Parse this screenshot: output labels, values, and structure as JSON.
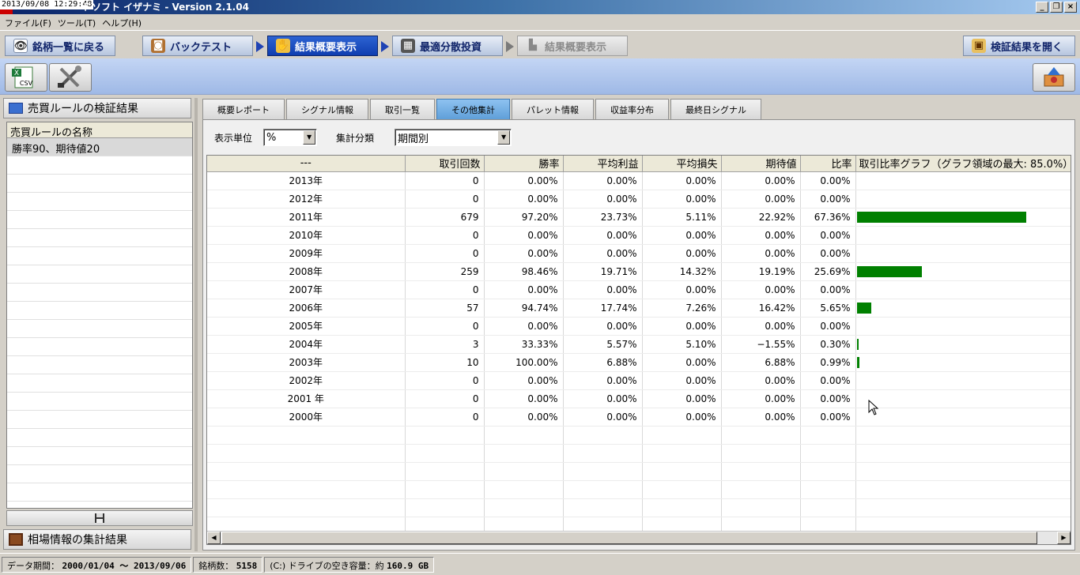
{
  "titlebar": {
    "timestamp": "2013/09/08 12:29:48",
    "title": "ドソフト イザナミ - Version 2.1.04",
    "buttons": {
      "minimize": "_",
      "restore": "❐",
      "close": "×"
    }
  },
  "menu": [
    "ファイル(F)",
    "ツール(T)",
    "ヘルプ(H)"
  ],
  "nav": {
    "back": "銘柄一覧に戻る",
    "backtest": "バックテスト",
    "summary": "結果概要表示",
    "optimal": "最適分散投資",
    "summary2": "結果概要表示",
    "open_results": "検証結果を開く",
    "icons": {
      "back": "eye-icon",
      "backtest": "bag-icon",
      "summary": "chart-hand-icon",
      "optimal": "grid-icon",
      "summary2": "bar-chart-icon",
      "open_results": "folder-icon"
    }
  },
  "toolbar": {
    "csv_label": "CSV"
  },
  "left_panel": {
    "header": "売買ルールの検証結果",
    "column_header": "売買ルールの名称",
    "rules": [
      "勝率90、期待値20"
    ],
    "footer": "相場情報の集計結果"
  },
  "tabs": [
    "概要レポート",
    "シグナル情報",
    "取引一覧",
    "その他集計",
    "パレット情報",
    "収益率分布",
    "最終日シグナル"
  ],
  "active_tab": 3,
  "filters": {
    "unit_label": "表示単位",
    "unit_value": "%",
    "category_label": "集計分類",
    "category_value": "期間別"
  },
  "table": {
    "headers": [
      "---",
      "取引回数",
      "勝率",
      "平均利益",
      "平均損失",
      "期待値",
      "比率",
      "取引比率グラフ（グラフ領域の最大: 85.0%）"
    ],
    "graph_max_percent": 85.0,
    "rows": [
      {
        "period": "2013年",
        "trades": "0",
        "win_rate": "0.00%",
        "avg_profit": "0.00%",
        "avg_loss": "0.00%",
        "expected": "0.00%",
        "ratio": "0.00%",
        "ratio_value": 0.0
      },
      {
        "period": "2012年",
        "trades": "0",
        "win_rate": "0.00%",
        "avg_profit": "0.00%",
        "avg_loss": "0.00%",
        "expected": "0.00%",
        "ratio": "0.00%",
        "ratio_value": 0.0
      },
      {
        "period": "2011年",
        "trades": "679",
        "win_rate": "97.20%",
        "avg_profit": "23.73%",
        "avg_loss": "5.11%",
        "expected": "22.92%",
        "ratio": "67.36%",
        "ratio_value": 67.36
      },
      {
        "period": "2010年",
        "trades": "0",
        "win_rate": "0.00%",
        "avg_profit": "0.00%",
        "avg_loss": "0.00%",
        "expected": "0.00%",
        "ratio": "0.00%",
        "ratio_value": 0.0
      },
      {
        "period": "2009年",
        "trades": "0",
        "win_rate": "0.00%",
        "avg_profit": "0.00%",
        "avg_loss": "0.00%",
        "expected": "0.00%",
        "ratio": "0.00%",
        "ratio_value": 0.0
      },
      {
        "period": "2008年",
        "trades": "259",
        "win_rate": "98.46%",
        "avg_profit": "19.71%",
        "avg_loss": "14.32%",
        "expected": "19.19%",
        "ratio": "25.69%",
        "ratio_value": 25.69
      },
      {
        "period": "2007年",
        "trades": "0",
        "win_rate": "0.00%",
        "avg_profit": "0.00%",
        "avg_loss": "0.00%",
        "expected": "0.00%",
        "ratio": "0.00%",
        "ratio_value": 0.0
      },
      {
        "period": "2006年",
        "trades": "57",
        "win_rate": "94.74%",
        "avg_profit": "17.74%",
        "avg_loss": "7.26%",
        "expected": "16.42%",
        "ratio": "5.65%",
        "ratio_value": 5.65
      },
      {
        "period": "2005年",
        "trades": "0",
        "win_rate": "0.00%",
        "avg_profit": "0.00%",
        "avg_loss": "0.00%",
        "expected": "0.00%",
        "ratio": "0.00%",
        "ratio_value": 0.0
      },
      {
        "period": "2004年",
        "trades": "3",
        "win_rate": "33.33%",
        "avg_profit": "5.57%",
        "avg_loss": "5.10%",
        "expected": "−1.55%",
        "ratio": "0.30%",
        "ratio_value": 0.3
      },
      {
        "period": "2003年",
        "trades": "10",
        "win_rate": "100.00%",
        "avg_profit": "6.88%",
        "avg_loss": "0.00%",
        "expected": "6.88%",
        "ratio": "0.99%",
        "ratio_value": 0.99
      },
      {
        "period": "2002年",
        "trades": "0",
        "win_rate": "0.00%",
        "avg_profit": "0.00%",
        "avg_loss": "0.00%",
        "expected": "0.00%",
        "ratio": "0.00%",
        "ratio_value": 0.0
      },
      {
        "period": "2001 年",
        "trades": "0",
        "win_rate": "0.00%",
        "avg_profit": "0.00%",
        "avg_loss": "0.00%",
        "expected": "0.00%",
        "ratio": "0.00%",
        "ratio_value": 0.0
      },
      {
        "period": "2000年",
        "trades": "0",
        "win_rate": "0.00%",
        "avg_profit": "0.00%",
        "avg_loss": "0.00%",
        "expected": "0.00%",
        "ratio": "0.00%",
        "ratio_value": 0.0
      }
    ],
    "empty_rows": 6
  },
  "status": {
    "data_period_label": "データ期間：",
    "data_period_value": "2000/01/04 〜 2013/09/06",
    "stock_count_label": "銘柄数：",
    "stock_count_value": "5158",
    "disk_label": "(C:) ドライブの空き容量：約",
    "disk_value": "160.9 GB"
  },
  "colors": {
    "bar": "#008000",
    "active_nav": "#1f4fc0",
    "active_tab": "#6aa8e0"
  }
}
